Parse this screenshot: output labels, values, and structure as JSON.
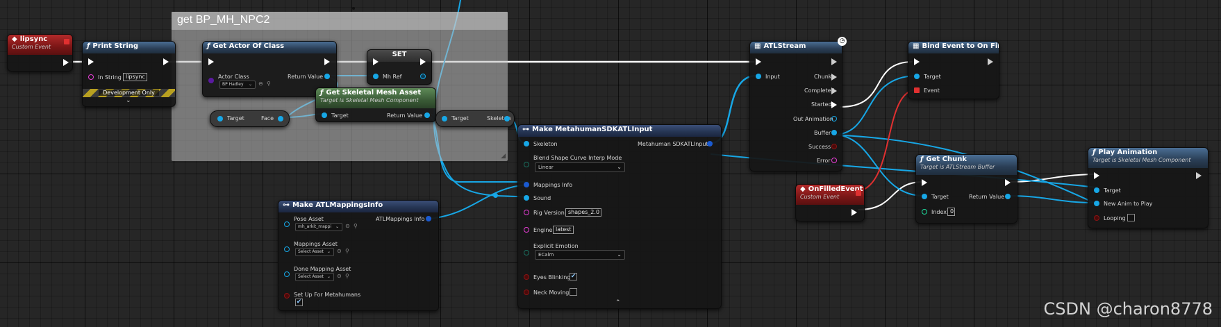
{
  "comment_box": {
    "title": "get BP_MH_NPC2"
  },
  "nodes": {
    "lipsync": {
      "title": "lipsync",
      "subtitle": "Custom Event"
    },
    "print_string": {
      "title": "Print String",
      "in_string_label": "In String",
      "in_string_value": "lipsync",
      "dev_label": "Development Only",
      "expand": "⌄"
    },
    "get_actor": {
      "title": "Get Actor Of Class",
      "actor_class_label": "Actor Class",
      "actor_class_value": "BP Hadley",
      "return_label": "Return Value"
    },
    "set": {
      "title": "SET",
      "mh_ref_label": "Mh Ref"
    },
    "get_skel": {
      "title": "Get Skeletal Mesh Asset",
      "subtitle": "Target is Skeletal Mesh Component",
      "target_label": "Target",
      "return_label": "Return Value"
    },
    "face_get": {
      "target_label": "Target",
      "face_label": "Face"
    },
    "skel_get": {
      "target_label": "Target",
      "skeleton_label": "Skeleton"
    },
    "make_sdk": {
      "title": "Make MetahumanSDKATLInput",
      "skeleton_label": "Skeleton",
      "output_label": "Metahuman SDKATLInput",
      "blend_label": "Blend Shape Curve Interp Mode",
      "blend_value": "Linear",
      "mappings_label": "Mappings Info",
      "sound_label": "Sound",
      "rig_label": "Rig Version",
      "rig_value": "shapes_2.0",
      "engine_label": "Engine",
      "engine_value": "latest",
      "emotion_label": "Explicit Emotion",
      "emotion_value": "ECalm",
      "eyes_label": "Eyes Blinking",
      "neck_label": "Neck Moving",
      "collapse": "⌃"
    },
    "make_atl": {
      "title": "Make ATLMappingsInfo",
      "pose_label": "Pose Asset",
      "pose_value": "mh_arkit_mappi",
      "output_label": "ATLMappings Info",
      "mappings_label": "Mappings Asset",
      "mappings_value": "Select Asset",
      "done_label": "Done Mapping Asset",
      "done_value": "Select Asset",
      "setup_label": "Set Up For Metahumans"
    },
    "atl_stream": {
      "title": "ATLStream",
      "input_label": "Input",
      "chunk_label": "Chunk",
      "completed_label": "Completed",
      "started_label": "Started",
      "out_anim_label": "Out Animation",
      "buffer_label": "Buffer",
      "success_label": "Success",
      "error_label": "Error"
    },
    "bind_event": {
      "title": "Bind Event to On Filled",
      "target_label": "Target",
      "event_label": "Event"
    },
    "on_filled": {
      "title": "OnFilledEvent",
      "subtitle": "Custom Event"
    },
    "get_chunk": {
      "title": "Get Chunk",
      "subtitle": "Target is ATLStream Buffer",
      "target_label": "Target",
      "return_label": "Return Value",
      "index_label": "Index",
      "index_value": "0"
    },
    "play_anim": {
      "title": "Play Animation",
      "subtitle": "Target is Skeletal Mesh Component",
      "target_label": "Target",
      "new_anim_label": "New Anim to Play",
      "looping_label": "Looping"
    }
  },
  "watermark": "CSDN @charon8778",
  "colors": {
    "exec": "#ffffff",
    "object": "#17a7e6",
    "struct": "#1a5ad0",
    "delegate": "#e03030",
    "event_header": "#b22a2a",
    "function_header": "#4a6e94",
    "pure_header": "#5e8a58"
  }
}
